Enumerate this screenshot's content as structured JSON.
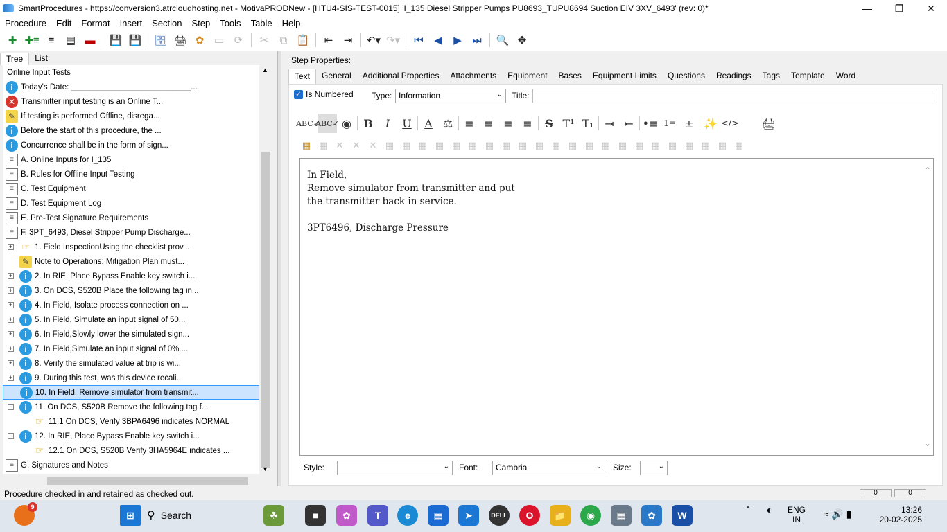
{
  "window": {
    "title": "SmartProcedures - https://conversion3.atrcloudhosting.net - MotivaPRODNew - [HTU4-SIS-TEST-0015] 'I_135 Diesel Stripper Pumps PU8693_TUPU8694 Suction EIV 3XV_6493' (rev: 0)*"
  },
  "menu": [
    "Procedure",
    "Edit",
    "Format",
    "Insert",
    "Section",
    "Step",
    "Tools",
    "Table",
    "Help"
  ],
  "left_tabs": [
    "Tree",
    "List"
  ],
  "tree": [
    {
      "label": "Online Input Tests",
      "icon": "none",
      "indent": 0,
      "exp": ""
    },
    {
      "label": "Today's Date: ___________________________...",
      "icon": "info",
      "indent": 0,
      "exp": ""
    },
    {
      "label": "Transmitter input testing is an Online T...",
      "icon": "err",
      "indent": 0,
      "exp": ""
    },
    {
      "label": "If testing is performed Offline, disrega...",
      "icon": "note",
      "indent": 0,
      "exp": ""
    },
    {
      "label": "Before the start of this procedure, the ...",
      "icon": "info",
      "indent": 0,
      "exp": ""
    },
    {
      "label": "Concurrence shall be in the form of sign...",
      "icon": "info",
      "indent": 0,
      "exp": ""
    },
    {
      "label": "A. Online Inputs for I_135",
      "icon": "doc",
      "indent": 0,
      "exp": ""
    },
    {
      "label": "B. Rules for Offline Input Testing",
      "icon": "doc",
      "indent": 0,
      "exp": ""
    },
    {
      "label": "C. Test Equipment",
      "icon": "doc",
      "indent": 0,
      "exp": ""
    },
    {
      "label": "D. Test Equipment Log",
      "icon": "doc",
      "indent": 0,
      "exp": ""
    },
    {
      "label": "E. Pre-Test Signature Requirements",
      "icon": "doc",
      "indent": 0,
      "exp": ""
    },
    {
      "label": "F. 3PT_6493, Diesel Stripper Pump Discharge...",
      "icon": "doc",
      "indent": 0,
      "exp": ""
    },
    {
      "label": "1. Field InspectionUsing the checklist prov...",
      "icon": "hand",
      "indent": 1,
      "exp": "+"
    },
    {
      "label": "Note to Operations: Mitigation Plan must...",
      "icon": "note",
      "indent": 1,
      "exp": ""
    },
    {
      "label": "2. In RIE, Place Bypass Enable key switch i...",
      "icon": "info",
      "indent": 1,
      "exp": "+"
    },
    {
      "label": "3. On DCS, S520B Place the following tag in...",
      "icon": "info",
      "indent": 1,
      "exp": "+"
    },
    {
      "label": "4. In Field, Isolate process connection on ...",
      "icon": "info",
      "indent": 1,
      "exp": "+"
    },
    {
      "label": "5. In Field, Simulate an input signal of 50...",
      "icon": "info",
      "indent": 1,
      "exp": "+"
    },
    {
      "label": "6. In Field,Slowly lower the simulated sign...",
      "icon": "info",
      "indent": 1,
      "exp": "+"
    },
    {
      "label": "7. In Field,Simulate an input signal of 0% ...",
      "icon": "info",
      "indent": 1,
      "exp": "+"
    },
    {
      "label": "8. Verify the simulated value at trip is wi...",
      "icon": "info",
      "indent": 1,
      "exp": "+"
    },
    {
      "label": "9. During this test, was this device recali...",
      "icon": "info",
      "indent": 1,
      "exp": "+"
    },
    {
      "label": "10. In Field, Remove simulator from transmit...",
      "icon": "info",
      "indent": 1,
      "exp": "+",
      "selected": true
    },
    {
      "label": "11. On DCS, S520B Remove the following tag f...",
      "icon": "info",
      "indent": 1,
      "exp": "-"
    },
    {
      "label": "11.1 On DCS, Verify 3BPA6496 indicates NORMAL",
      "icon": "hand",
      "indent": 2,
      "exp": ""
    },
    {
      "label": "12. In RIE, Place Bypass Enable key switch i...",
      "icon": "info",
      "indent": 1,
      "exp": "-"
    },
    {
      "label": "12.1 On DCS, S520B Verify 3HA5964E indicates ...",
      "icon": "hand",
      "indent": 2,
      "exp": ""
    },
    {
      "label": "G. Signatures and Notes",
      "icon": "doc",
      "indent": 0,
      "exp": ""
    }
  ],
  "step_props": {
    "heading": "Step Properties:",
    "tabs": [
      "Text",
      "General",
      "Additional Properties",
      "Attachments",
      "Equipment",
      "Bases",
      "Equipment Limits",
      "Questions",
      "Readings",
      "Tags",
      "Template",
      "Word"
    ],
    "is_numbered_label": "Is Numbered",
    "type_label": "Type:",
    "type_value": "Information",
    "title_label": "Title:"
  },
  "editor_lines": [
    "In Field,",
    "Remove simulator from transmitter and put",
    "the transmitter back in service.",
    "",
    "3PT6496, Discharge Pressure"
  ],
  "bottom": {
    "style_label": "Style:",
    "style_value": "",
    "font_label": "Font:",
    "font_value": "Cambria",
    "size_label": "Size:",
    "size_value": ""
  },
  "status": {
    "text": "Procedure checked in and retained as checked out.",
    "box1": "0",
    "box2": "0"
  },
  "taskbar": {
    "search": "Search",
    "badge": "9",
    "lang_line1": "ENG",
    "lang_line2": "IN",
    "time": "13:26",
    "date": "20-02-2025"
  }
}
